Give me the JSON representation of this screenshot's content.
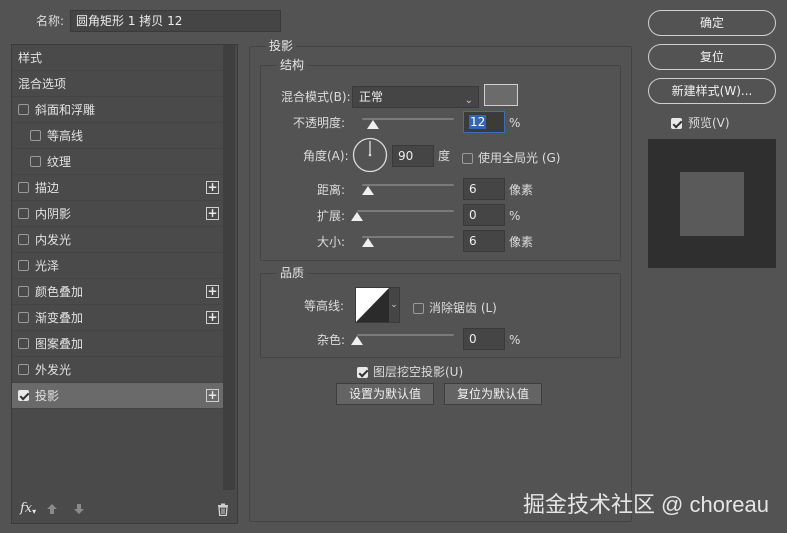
{
  "header": {
    "name_label": "名称:",
    "name_value": "圆角矩形 1 拷贝 12"
  },
  "style_list": {
    "items": [
      {
        "label": "样式",
        "checkbox": false,
        "checked": false,
        "plus": false,
        "indent": 0,
        "selected": false
      },
      {
        "label": "混合选项",
        "checkbox": false,
        "checked": false,
        "plus": false,
        "indent": 0,
        "selected": false
      },
      {
        "label": "斜面和浮雕",
        "checkbox": true,
        "checked": false,
        "plus": false,
        "indent": 0,
        "selected": false
      },
      {
        "label": "等高线",
        "checkbox": true,
        "checked": false,
        "plus": false,
        "indent": 1,
        "selected": false
      },
      {
        "label": "纹理",
        "checkbox": true,
        "checked": false,
        "plus": false,
        "indent": 1,
        "selected": false
      },
      {
        "label": "描边",
        "checkbox": true,
        "checked": false,
        "plus": true,
        "indent": 0,
        "selected": false
      },
      {
        "label": "内阴影",
        "checkbox": true,
        "checked": false,
        "plus": true,
        "indent": 0,
        "selected": false
      },
      {
        "label": "内发光",
        "checkbox": true,
        "checked": false,
        "plus": false,
        "indent": 0,
        "selected": false
      },
      {
        "label": "光泽",
        "checkbox": true,
        "checked": false,
        "plus": false,
        "indent": 0,
        "selected": false
      },
      {
        "label": "颜色叠加",
        "checkbox": true,
        "checked": false,
        "plus": true,
        "indent": 0,
        "selected": false
      },
      {
        "label": "渐变叠加",
        "checkbox": true,
        "checked": false,
        "plus": true,
        "indent": 0,
        "selected": false
      },
      {
        "label": "图案叠加",
        "checkbox": true,
        "checked": false,
        "plus": false,
        "indent": 0,
        "selected": false
      },
      {
        "label": "外发光",
        "checkbox": true,
        "checked": false,
        "plus": false,
        "indent": 0,
        "selected": false
      },
      {
        "label": "投影",
        "checkbox": true,
        "checked": true,
        "plus": true,
        "indent": 0,
        "selected": true
      }
    ],
    "footer": {
      "fx_label": "fx",
      "fx_icon": "fx-icon",
      "up_icon": "arrow-up-icon",
      "down_icon": "arrow-down-icon",
      "trash_icon": "trash-icon"
    }
  },
  "drop_shadow": {
    "title": "投影",
    "structure": {
      "title": "结构",
      "blend_mode_label": "混合模式(B):",
      "blend_mode_value": "正常",
      "shadow_color": "#6b6b6b",
      "opacity_label": "不透明度:",
      "opacity_value": "12",
      "opacity_unit": "%",
      "opacity_fraction": 0.12,
      "angle_label": "角度(A):",
      "angle_value": "90",
      "angle_unit": "度",
      "global_light_label": "使用全局光 (G)",
      "global_light_checked": false,
      "distance_label": "距离:",
      "distance_value": "6",
      "distance_unit": "像素",
      "distance_fraction": 0.06,
      "spread_label": "扩展:",
      "spread_value": "0",
      "spread_unit": "%",
      "spread_fraction": 0.0,
      "size_label": "大小:",
      "size_value": "6",
      "size_unit": "像素",
      "size_fraction": 0.06
    },
    "quality": {
      "title": "品质",
      "contour_label": "等高线:",
      "anti_alias_label": "消除锯齿 (L)",
      "anti_alias_checked": false,
      "noise_label": "杂色:",
      "noise_value": "0",
      "noise_unit": "%",
      "noise_fraction": 0.0
    },
    "knockout_label": "图层挖空投影(U)",
    "knockout_checked": true,
    "make_default_label": "设置为默认值",
    "reset_default_label": "复位为默认值"
  },
  "buttons": {
    "ok_label": "确定",
    "reset_label": "复位",
    "new_style_label": "新建样式(W)...",
    "preview_label": "预览(V)",
    "preview_checked": true
  },
  "watermark": "掘金技术社区 @ choreau",
  "colors": {
    "panel_bg": "#535353",
    "preview_bg": "#2f2f2f",
    "preview_swatch": "#5a5a5a"
  }
}
